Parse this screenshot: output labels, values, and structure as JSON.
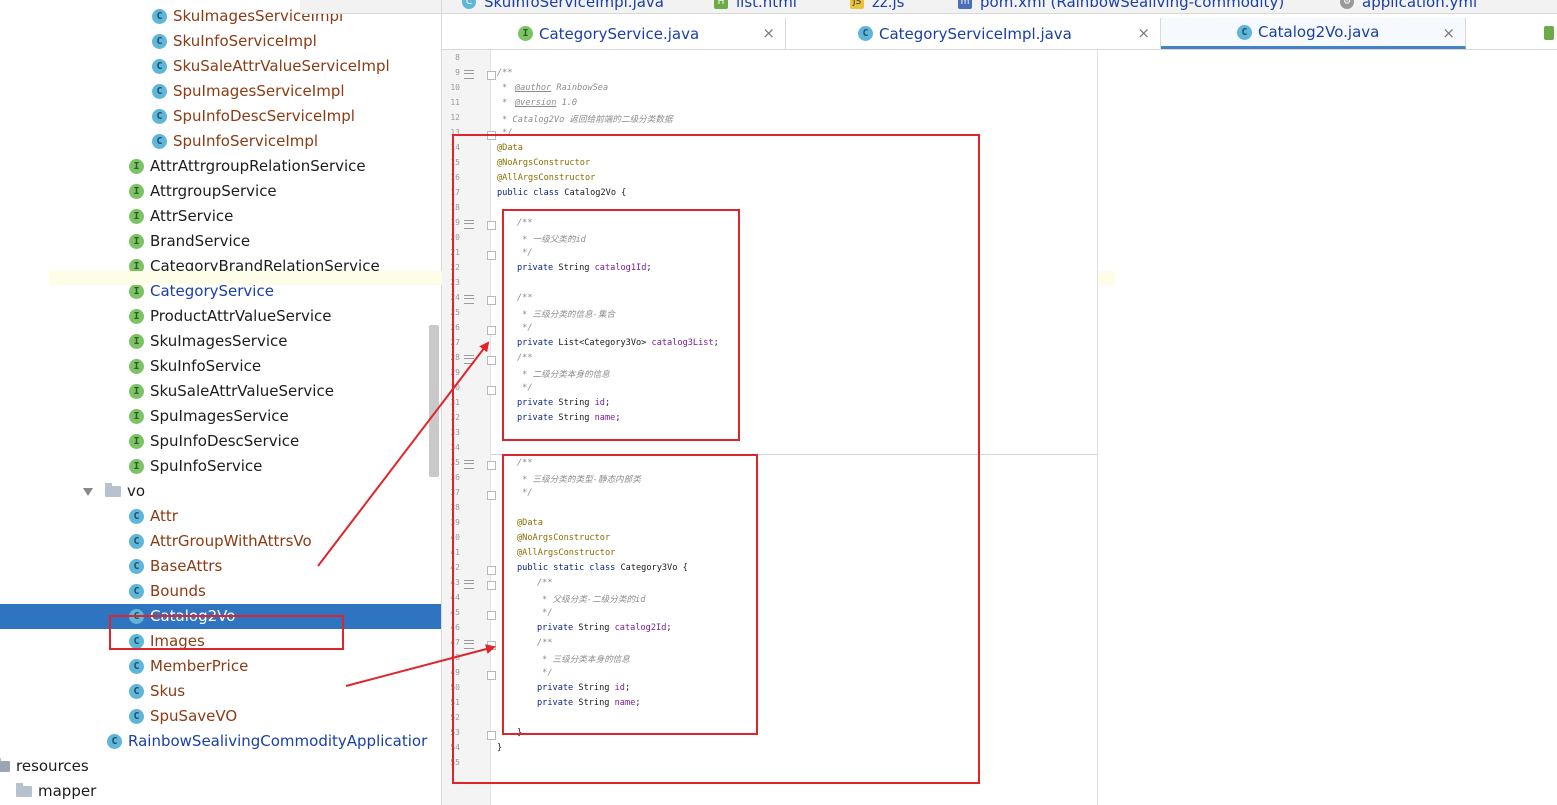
{
  "top_tabs": [
    {
      "label": "SkuInfoServiceImpl.java",
      "icon": "class-icon"
    },
    {
      "label": "list.html",
      "icon": "html-icon"
    },
    {
      "label": "zz.js",
      "icon": "js-icon"
    },
    {
      "label": "pom.xml (RainbowSealiving-commodity)",
      "icon": "maven-icon"
    },
    {
      "label": "application.yml",
      "icon": "yml-icon"
    }
  ],
  "editor_tabs": [
    {
      "label": "CategoryService.java",
      "icon": "interface-icon",
      "close": "×"
    },
    {
      "label": "CategoryServiceImpl.java",
      "icon": "class-icon",
      "close": "×"
    },
    {
      "label": "Catalog2Vo.java",
      "icon": "class-icon",
      "close": "×",
      "active": true
    }
  ],
  "tree": {
    "impl_items": [
      {
        "label": "SkuImagesServiceImpl",
        "type": "C"
      },
      {
        "label": "SkuInfoServiceImpl",
        "type": "C"
      },
      {
        "label": "SkuSaleAttrValueServiceImpl",
        "type": "C"
      },
      {
        "label": "SpuImagesServiceImpl",
        "type": "C"
      },
      {
        "label": "SpuInfoDescServiceImpl",
        "type": "C"
      },
      {
        "label": "SpuInfoServiceImpl",
        "type": "C"
      }
    ],
    "service_items": [
      {
        "label": "AttrAttrgroupRelationService",
        "type": "I",
        "color": "normal"
      },
      {
        "label": "AttrgroupService",
        "type": "I",
        "color": "normal"
      },
      {
        "label": "AttrService",
        "type": "I",
        "color": "normal"
      },
      {
        "label": "BrandService",
        "type": "I",
        "color": "black"
      },
      {
        "label": "CategoryBrandRelationService",
        "type": "I",
        "color": "normal"
      },
      {
        "label": "CategoryService",
        "type": "I",
        "color": "blue"
      },
      {
        "label": "ProductAttrValueService",
        "type": "I",
        "color": "normal"
      },
      {
        "label": "SkuImagesService",
        "type": "I",
        "color": "normal"
      },
      {
        "label": "SkuInfoService",
        "type": "I",
        "color": "normal"
      },
      {
        "label": "SkuSaleAttrValueService",
        "type": "I",
        "color": "normal"
      },
      {
        "label": "SpuImagesService",
        "type": "I",
        "color": "normal"
      },
      {
        "label": "SpuInfoDescService",
        "type": "I",
        "color": "normal"
      },
      {
        "label": "SpuInfoService",
        "type": "I",
        "color": "normal"
      }
    ],
    "vo_folder": "vo",
    "vo_items": [
      {
        "label": "Attr",
        "type": "C"
      },
      {
        "label": "AttrGroupWithAttrsVo",
        "type": "C"
      },
      {
        "label": "BaseAttrs",
        "type": "C"
      },
      {
        "label": "Bounds",
        "type": "C"
      },
      {
        "label": "Catalog2Vo",
        "type": "C",
        "selected": true
      },
      {
        "label": "Images",
        "type": "C"
      },
      {
        "label": "MemberPrice",
        "type": "C"
      },
      {
        "label": "Skus",
        "type": "C"
      },
      {
        "label": "SpuSaveVO",
        "type": "C"
      }
    ],
    "app_class": "RainbowSealivingCommodityApplicatior",
    "resources": "resources",
    "mapper": "mapper"
  },
  "code": {
    "line_numbers": [
      "8",
      "9",
      "10",
      "11",
      "12",
      "13",
      "14",
      "15",
      "16",
      "17",
      "18",
      "19",
      "20",
      "21",
      "22",
      "23",
      "24",
      "25",
      "26",
      "27",
      "28",
      "29",
      "30",
      "31",
      "32",
      "33",
      "34",
      "35",
      "36",
      "37",
      "38",
      "39",
      "40",
      "41",
      "42",
      "43",
      "44",
      "45",
      "46",
      "47",
      "48",
      "49",
      "50",
      "51",
      "52",
      "53",
      "54",
      "55"
    ],
    "lines": {
      "l9": "/**",
      "l10_tag": "@author",
      "l10_rest": " RainbowSea",
      "l11_tag": "@version",
      "l11_rest": " 1.0",
      "l12": " * Catalog2Vo 返回给前端的二级分类数据",
      "l13": " */",
      "l14": "@Data",
      "l15": "@NoArgsConstructor",
      "l16": "@AllArgsConstructor",
      "l17_kw": "public class",
      "l17_rest": " Catalog2Vo {",
      "l19": "/**",
      "l20": " * 一级父类的id",
      "l21": " */",
      "l22_kw": "private",
      "l22_type": " String ",
      "l22_field": "catalog1Id",
      "l22_end": ";",
      "l24": "/**",
      "l25": " * 三级分类的信息-集合",
      "l26": " */",
      "l27_kw": "private",
      "l27_type": " List<Category3Vo> ",
      "l27_field": "catalog3List",
      "l27_end": ";",
      "l28": "/**",
      "l29": " * 二级分类本身的信息",
      "l30": " */",
      "l31_kw": "private",
      "l31_type": " String ",
      "l31_field": "id",
      "l31_end": ";",
      "l32_kw": "private",
      "l32_type": " String ",
      "l32_field": "name",
      "l32_end": ";",
      "l35": "/**",
      "l36": " * 三级分类的类型-静态内部类",
      "l37": " */",
      "l39": "@Data",
      "l40": "@NoArgsConstructor",
      "l41": "@AllArgsConstructor",
      "l42_kw": "public static class",
      "l42_rest": " Category3Vo {",
      "l43": "/**",
      "l44": " * 父级分类-二级分类的id",
      "l45": " */",
      "l46_kw": "private",
      "l46_type": " String ",
      "l46_field": "catalog2Id",
      "l46_end": ";",
      "l47": "/**",
      "l48": " * 三级分类本身的信息",
      "l49": " */",
      "l50_kw": "private",
      "l50_type": " String ",
      "l50_field": "id",
      "l50_end": ";",
      "l51_kw": "private",
      "l51_type": " String ",
      "l51_field": "name",
      "l51_end": ";",
      "l53": "}",
      "l54": "}"
    }
  },
  "colors": {
    "annotation_red": "#e0242c",
    "selection_blue": "#2f74c0",
    "link_blue": "#1a3fa8"
  }
}
